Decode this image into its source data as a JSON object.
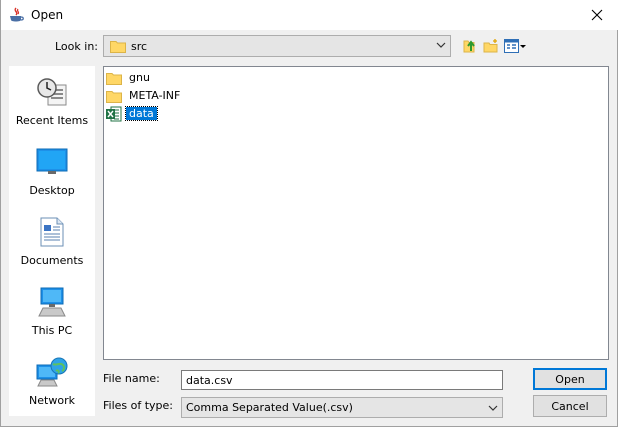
{
  "window": {
    "title": "Open"
  },
  "look_in": {
    "label": "Look in:",
    "value": "src"
  },
  "toolbar": {
    "icons": [
      "up-one-level-icon",
      "new-folder-icon",
      "view-menu-icon"
    ]
  },
  "places": [
    {
      "label": "Recent Items",
      "icon": "recent-items-icon"
    },
    {
      "label": "Desktop",
      "icon": "desktop-icon"
    },
    {
      "label": "Documents",
      "icon": "documents-icon"
    },
    {
      "label": "This PC",
      "icon": "this-pc-icon"
    },
    {
      "label": "Network",
      "icon": "network-icon"
    }
  ],
  "files": [
    {
      "name": "gnu",
      "type": "folder",
      "selected": false
    },
    {
      "name": "META-INF",
      "type": "folder",
      "selected": false
    },
    {
      "name": "data",
      "type": "excel-csv",
      "selected": true
    }
  ],
  "file_name": {
    "label": "File name:",
    "value": "data.csv"
  },
  "file_type": {
    "label": "Files of type:",
    "value": "Comma Separated Value(.csv)"
  },
  "buttons": {
    "open": "Open",
    "cancel": "Cancel"
  },
  "colors": {
    "selection": "#0078d7",
    "folder": "#ffd766",
    "default_button_border": "#0078d7"
  }
}
